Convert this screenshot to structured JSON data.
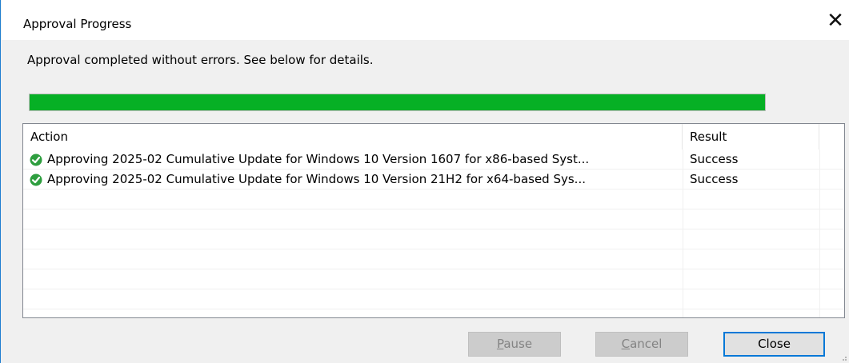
{
  "window": {
    "title": "Approval Progress",
    "close_glyph": "✕"
  },
  "message": "Approval completed without errors. See below for details.",
  "progress": {
    "percent": 100,
    "color": "#06b025"
  },
  "list": {
    "columns": [
      "Action",
      "Result"
    ],
    "rows": [
      {
        "icon": "green-check-icon",
        "action": "Approving 2025-02 Cumulative Update for Windows 10 Version 1607 for x86-based Syst...",
        "result": "Success"
      },
      {
        "icon": "green-check-icon",
        "action": "Approving 2025-02 Cumulative Update for Windows 10 Version 21H2 for x64-based Sys...",
        "result": "Success"
      }
    ]
  },
  "buttons": {
    "pause": {
      "before": "",
      "mnemonic": "P",
      "after": "ause",
      "enabled": false
    },
    "cancel": {
      "before": "",
      "mnemonic": "C",
      "after": "ancel",
      "enabled": false
    },
    "close": {
      "label": "Close",
      "enabled": true
    }
  }
}
